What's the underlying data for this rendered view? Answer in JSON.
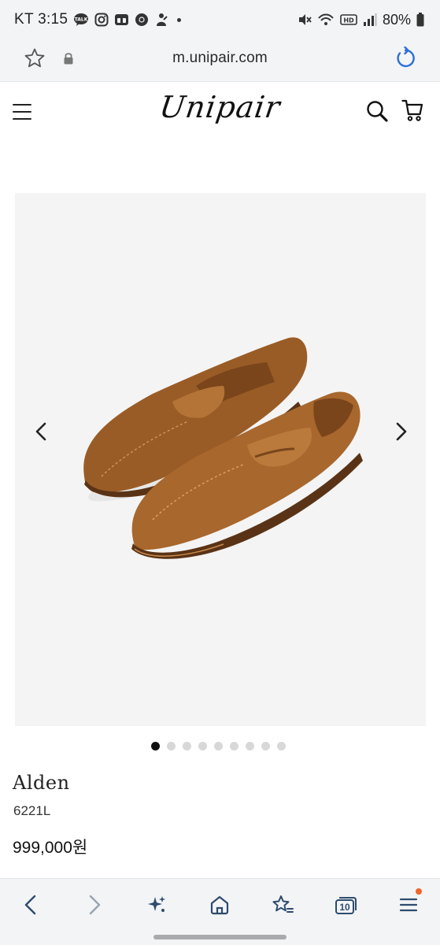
{
  "status_bar": {
    "carrier_time": "KT 3:15",
    "battery": "80%",
    "left_icons": [
      "kakaotalk-icon",
      "instagram-icon",
      "calendar-icon",
      "chrome-icon",
      "app-icon"
    ],
    "right_icons": [
      "mute-icon",
      "wifi-icon",
      "hd-icon",
      "signal-icon",
      "battery-icon"
    ]
  },
  "browser": {
    "url": "m.unipair.com"
  },
  "site": {
    "logo": "Unipair"
  },
  "product": {
    "image_alt": "Alden suede penny loafers",
    "image_count": 9,
    "active_image": 0,
    "brand": "Alden",
    "model": "6221L",
    "price": "999,000원"
  },
  "toolbar": {
    "tabs_count": "10"
  },
  "colors": {
    "accent": "#2e4b6e",
    "badge": "#f0652a",
    "suede": "#a8672d"
  }
}
